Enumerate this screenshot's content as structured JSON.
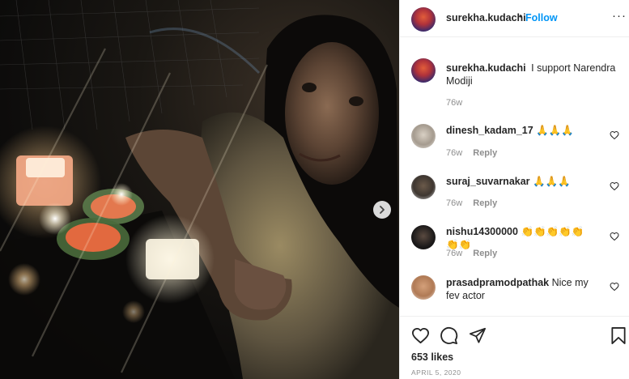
{
  "post": {
    "author": "surekha.kudachi",
    "follow_label": "Follow",
    "separator": "•",
    "more_label": "···"
  },
  "caption": {
    "username": "surekha.kudachi",
    "text": "I support Narendra Modiji",
    "time": "76w"
  },
  "comments": [
    {
      "username": "dinesh_kadam_17",
      "text": "🙏🙏🙏",
      "time": "76w",
      "reply_label": "Reply"
    },
    {
      "username": "suraj_suvarnakar",
      "text": "🙏🙏🙏",
      "time": "76w",
      "reply_label": "Reply"
    },
    {
      "username": "nishu14300000",
      "text": "👏👏👏👏👏👏👏",
      "time": "76w",
      "reply_label": "Reply"
    },
    {
      "username": "prasadpramodpathak",
      "text": "Nice my fev actor"
    }
  ],
  "stats": {
    "likes": "653 likes",
    "date": "APRIL 5, 2020"
  },
  "colors": {
    "link_blue": "#0095f6",
    "muted_gray": "#8e8e8e",
    "text": "#262626"
  },
  "icons": [
    "heart-icon",
    "comment-icon",
    "share-icon",
    "bookmark-icon",
    "chevron-right-icon",
    "more-icon"
  ]
}
